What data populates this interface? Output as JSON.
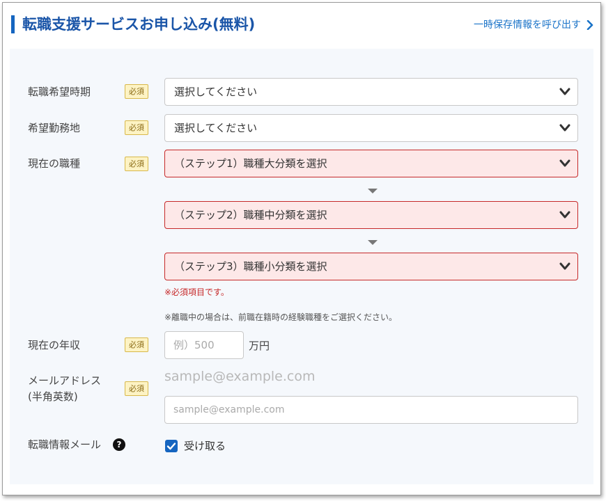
{
  "header": {
    "title": "転職支援サービスお申し込み(無料)",
    "save_link": "一時保存情報を呼び出す"
  },
  "form": {
    "required_badge": "必須",
    "timing": {
      "label": "転職希望時期",
      "value": "選択してください"
    },
    "location": {
      "label": "希望勤務地",
      "value": "選択してください"
    },
    "job": {
      "label": "現在の職種",
      "step1": "（ステップ1）職種大分類を選択",
      "step2": "（ステップ2）職種中分類を選択",
      "step3": "（ステップ3）職種小分類を選択",
      "error": "※必須項目です。",
      "note": "※離職中の場合は、前職在籍時の経験職種をご選択ください。"
    },
    "income": {
      "label": "現在の年収",
      "placeholder": "例）500",
      "unit": "万円"
    },
    "email": {
      "label_line1": "メールアドレス",
      "label_line2": "(半角英数)",
      "hint": "sample@example.com",
      "placeholder": "sample@example.com"
    },
    "newsletter": {
      "label": "転職情報メール",
      "help": "?",
      "checkbox_label": "受け取る",
      "checked": true
    }
  },
  "colors": {
    "accent": "#1565c0",
    "title": "#1a55a8",
    "error": "#c62828",
    "error_bg": "#fde8e8",
    "badge_bg": "#fdf3c4"
  }
}
